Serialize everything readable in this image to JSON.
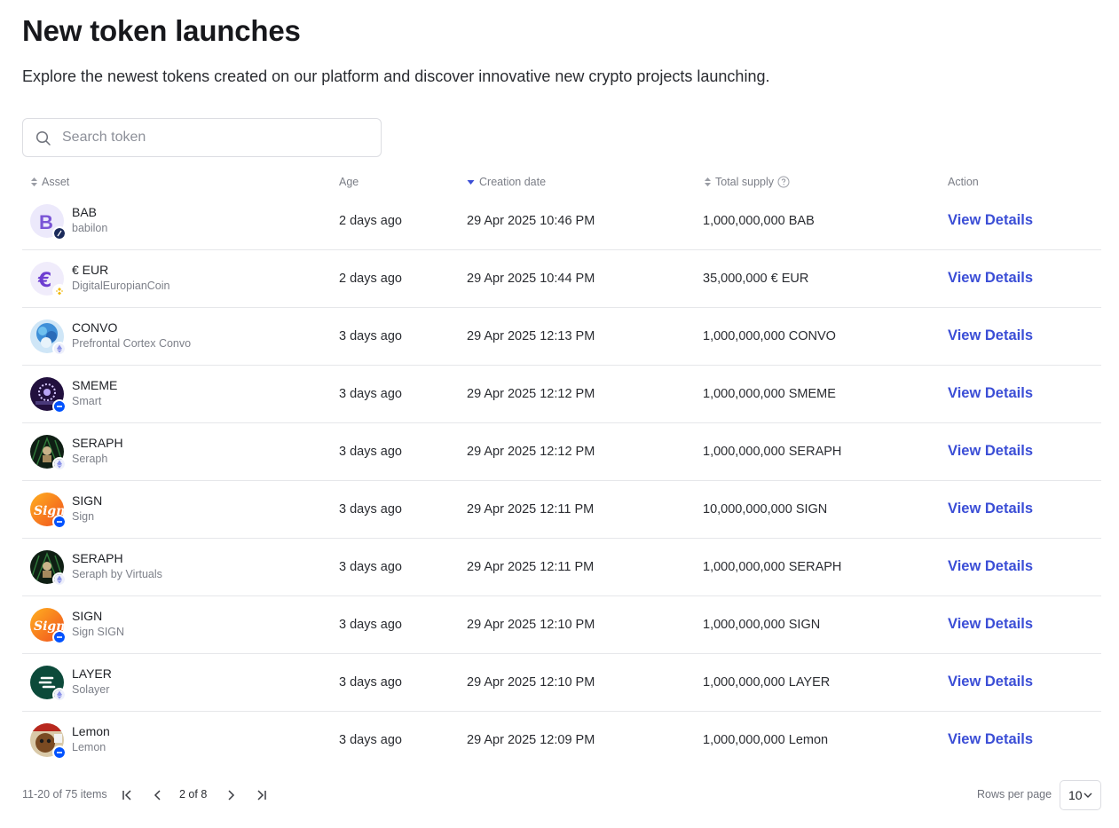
{
  "header": {
    "title": "New token launches",
    "subtitle": "Explore the newest tokens created on our platform and discover innovative new crypto projects launching."
  },
  "search": {
    "placeholder": "Search token",
    "value": "",
    "icon": "search-icon"
  },
  "columns": {
    "asset": "Asset",
    "age": "Age",
    "creation_date": "Creation date",
    "total_supply": "Total supply",
    "action": "Action"
  },
  "rows": [
    {
      "symbol": "BAB",
      "name": "babilon",
      "age": "2 days ago",
      "date": "29 Apr 2025 10:46 PM",
      "supply": "1,000,000,000 BAB",
      "action": "View Details",
      "chain": "base-chain-icon"
    },
    {
      "symbol": "€ EUR",
      "name": "DigitalEuropianCoin",
      "age": "2 days ago",
      "date": "29 Apr 2025 10:44 PM",
      "supply": "35,000,000 € EUR",
      "action": "View Details",
      "chain": "bnb-chain-icon"
    },
    {
      "symbol": "CONVO",
      "name": "Prefrontal Cortex Convo",
      "age": "3 days ago",
      "date": "29 Apr 2025 12:13 PM",
      "supply": "1,000,000,000 CONVO",
      "action": "View Details",
      "chain": "ethereum-chain-icon"
    },
    {
      "symbol": "SMEME",
      "name": "Smart",
      "age": "3 days ago",
      "date": "29 Apr 2025 12:12 PM",
      "supply": "1,000,000,000 SMEME",
      "action": "View Details",
      "chain": "base-chain-icon"
    },
    {
      "symbol": "SERAPH",
      "name": "Seraph",
      "age": "3 days ago",
      "date": "29 Apr 2025 12:12 PM",
      "supply": "1,000,000,000 SERAPH",
      "action": "View Details",
      "chain": "ethereum-chain-icon"
    },
    {
      "symbol": "SIGN",
      "name": "Sign",
      "age": "3 days ago",
      "date": "29 Apr 2025 12:11 PM",
      "supply": "10,000,000,000 SIGN",
      "action": "View Details",
      "chain": "base-chain-icon"
    },
    {
      "symbol": "SERAPH",
      "name": "Seraph by Virtuals",
      "age": "3 days ago",
      "date": "29 Apr 2025 12:11 PM",
      "supply": "1,000,000,000 SERAPH",
      "action": "View Details",
      "chain": "ethereum-chain-icon"
    },
    {
      "symbol": "SIGN",
      "name": "Sign SIGN",
      "age": "3 days ago",
      "date": "29 Apr 2025 12:10 PM",
      "supply": "1,000,000,000 SIGN",
      "action": "View Details",
      "chain": "base-chain-icon"
    },
    {
      "symbol": "LAYER",
      "name": "Solayer",
      "age": "3 days ago",
      "date": "29 Apr 2025 12:10 PM",
      "supply": "1,000,000,000 LAYER",
      "action": "View Details",
      "chain": "ethereum-chain-icon"
    },
    {
      "symbol": "Lemon",
      "name": "Lemon",
      "age": "3 days ago",
      "date": "29 Apr 2025 12:09 PM",
      "supply": "1,000,000,000 Lemon",
      "action": "View Details",
      "chain": "base-chain-icon"
    }
  ],
  "pagination": {
    "range": "11-20 of 75 items",
    "page": "2 of 8",
    "rows_label": "Rows per page",
    "rows_value": "10"
  },
  "colors": {
    "link": "#3b4ed6",
    "sort_active": "#3b4ed6",
    "border": "#e6e7ea"
  }
}
